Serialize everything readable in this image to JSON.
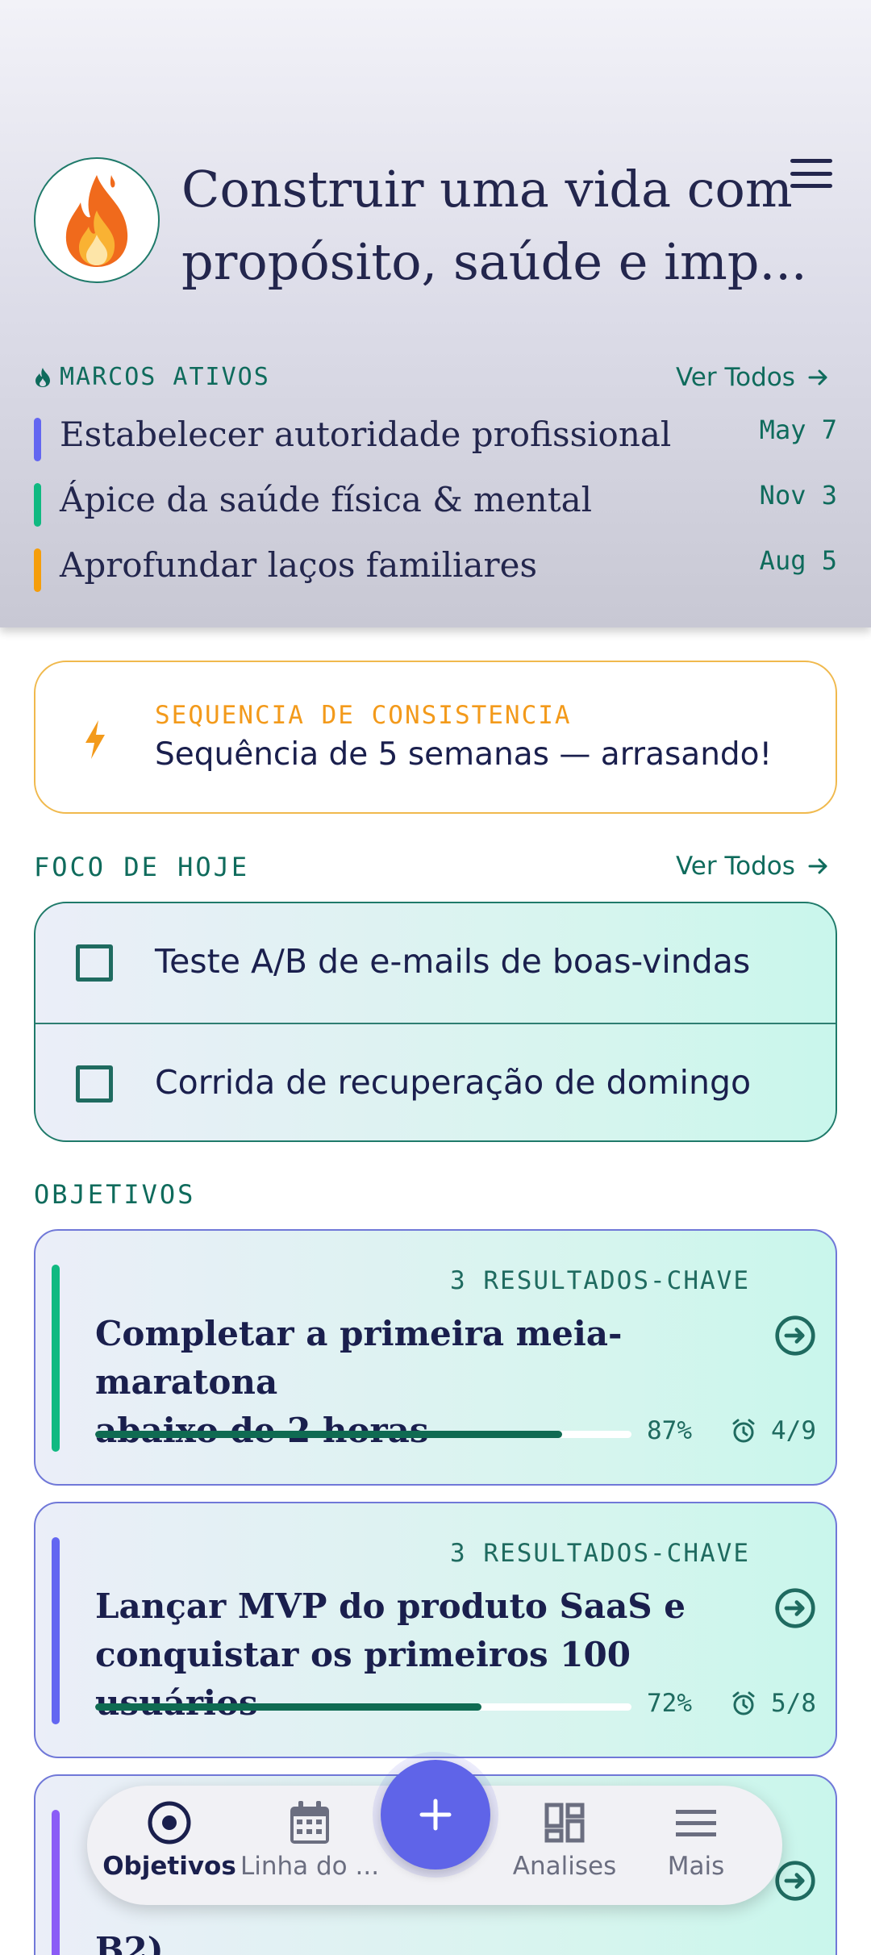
{
  "header": {
    "title_line1": "Construir uma vida com",
    "title_line2": "propósito, saúde e imp...",
    "avatar_icon": "fire-icon",
    "menu_icon": "hamburger-menu-icon"
  },
  "milestones": {
    "label": "MARCOS ATIVOS",
    "see_all": "Ver Todos",
    "items": [
      {
        "name": "Estabelecer autoridade profissional",
        "date": "May 7",
        "color": "#6366f1"
      },
      {
        "name": "Ápice da saúde física & mental",
        "date": "Nov 3",
        "color": "#10b981"
      },
      {
        "name": "Aprofundar laços familiares",
        "date": "Aug 5",
        "color": "#f59e0b"
      }
    ]
  },
  "streak": {
    "label": "SEQUENCIA DE CONSISTENCIA",
    "text": "Sequência de 5 semanas — arrasando!",
    "icon": "lightning-icon"
  },
  "focus": {
    "label": "FOCO DE HOJE",
    "see_all": "Ver Todos",
    "items": [
      {
        "text": "Teste A/B de e-mails de boas-vindas",
        "checked": false
      },
      {
        "text": "Corrida de recuperação de domingo",
        "checked": false
      }
    ]
  },
  "objectives": {
    "label": "OBJETIVOS",
    "items": [
      {
        "key_results": "3 RESULTADOS-CHAVE",
        "line1": "Completar a primeira meia-maratona",
        "line2": "abaixo de 2 horas",
        "progress": 87,
        "progress_label": "87%",
        "count": "4/9",
        "color": "#10b981"
      },
      {
        "key_results": "3 RESULTADOS-CHAVE",
        "line1": "Lançar MVP do produto SaaS e",
        "line2": "conquistar os primeiros 100 usuários",
        "progress": 72,
        "progress_label": "72%",
        "count": "5/8",
        "color": "#6366f1"
      },
      {
        "line1": "B2)",
        "color": "#8b5cf6"
      }
    ]
  },
  "nav": {
    "items": [
      {
        "label": "Objetivos",
        "icon": "target-icon",
        "active": true
      },
      {
        "label": "Linha do ...",
        "icon": "calendar-icon",
        "active": false
      },
      {
        "label": "Analises",
        "icon": "dashboard-icon",
        "active": false
      },
      {
        "label": "Mais",
        "icon": "menu-icon",
        "active": false
      }
    ],
    "fab_label": "+"
  }
}
